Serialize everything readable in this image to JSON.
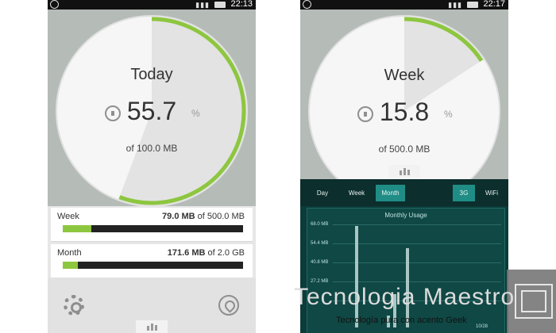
{
  "phone_left": {
    "status_time": "22:13",
    "gauge": {
      "period": "Today",
      "value": "55.7",
      "unit": "%",
      "total": "of 100.0 MB",
      "fill_fraction": 0.557
    },
    "stats": [
      {
        "label": "Week",
        "used": "79.0 MB",
        "of_text": "of 500.0 MB",
        "fill_fraction": 0.158
      },
      {
        "label": "Month",
        "used": "171.6 MB",
        "of_text": "of 2.0 GB",
        "fill_fraction": 0.084
      }
    ],
    "icons": {
      "settings": "gear-icon",
      "location": "location-icon",
      "chart": "bar-chart-icon"
    }
  },
  "phone_right": {
    "status_time": "22:17",
    "gauge": {
      "period": "Week",
      "value": "15.8",
      "unit": "%",
      "total": "of 500.0 MB",
      "fill_fraction": 0.158
    },
    "tabs": {
      "day": "Day",
      "week": "Week",
      "month": "Month",
      "g3": "3G",
      "wifi": "WiFi"
    },
    "chart_title": "Monthly Usage",
    "y_ticks": [
      "68.0 MB",
      "54.4 MB",
      "40.8 MB",
      "27.2 MB"
    ],
    "bars": [
      {
        "height": 1.0
      },
      {
        "height": 0.0
      },
      {
        "height": 0.0
      },
      {
        "height": 0.0
      },
      {
        "height": 0.0
      },
      {
        "height": 0.12
      },
      {
        "height": 0.33
      },
      {
        "height": 0.0
      },
      {
        "height": 0.78
      }
    ],
    "x_tick_right": "10/28"
  },
  "watermark": {
    "title": "Tecnologia Maestro",
    "subtitle": "Tecnología pura con acento Geek"
  }
}
